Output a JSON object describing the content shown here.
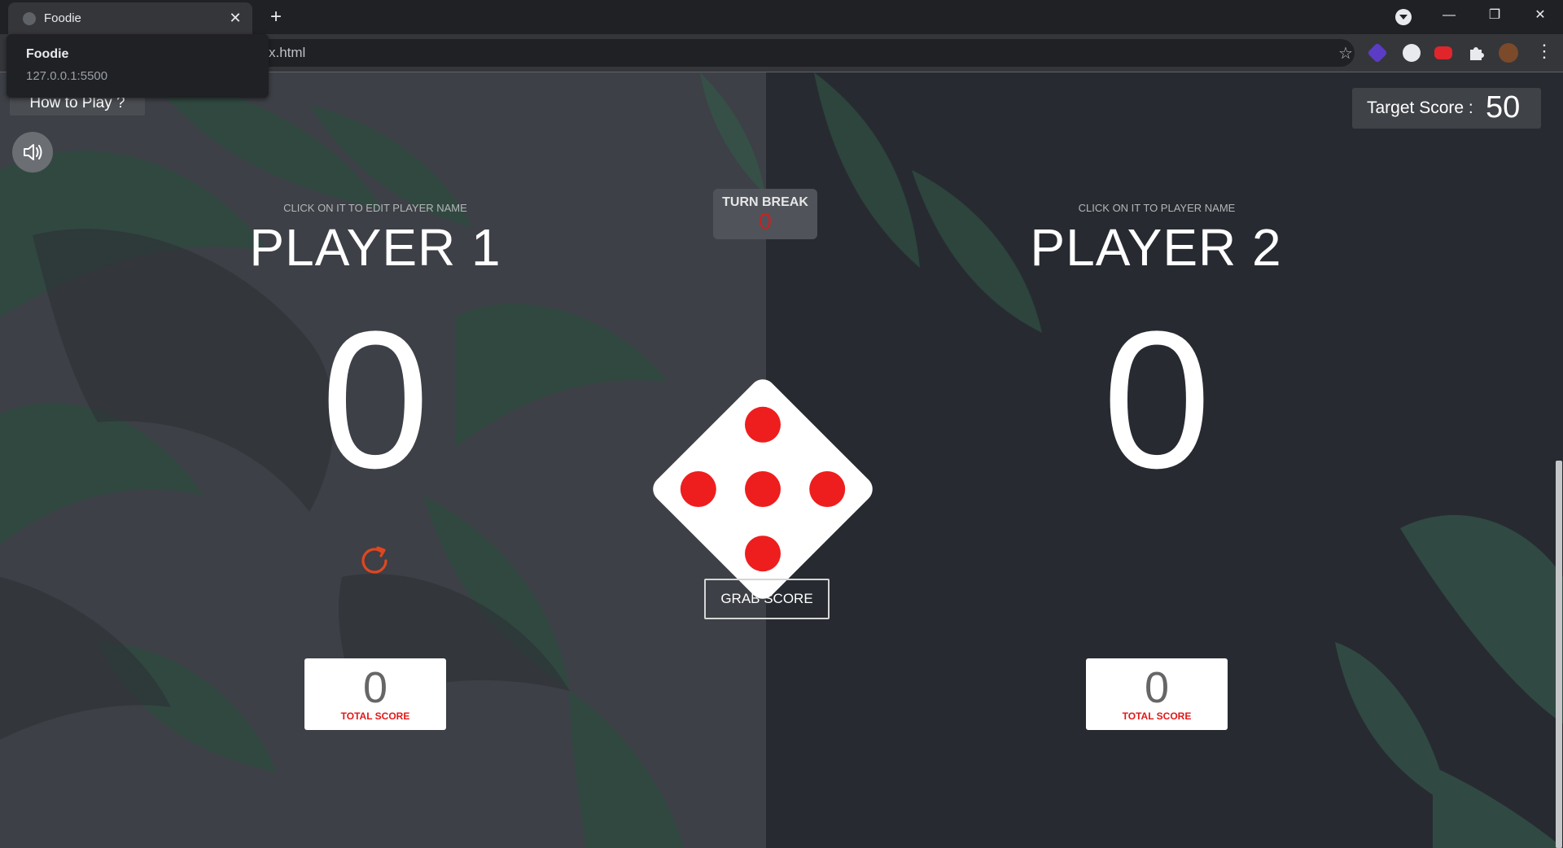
{
  "browser": {
    "tab_title": "Foodie",
    "tab_close": "✕",
    "new_tab": "+",
    "url_visible": "x.html",
    "tooltip_title": "Foodie",
    "tooltip_url": "127.0.0.1:5500",
    "window_controls": {
      "minimize": "—",
      "restore": "❐",
      "close": "✕"
    },
    "menu": "⋮",
    "star": "☆"
  },
  "game": {
    "how_to_play": "How to Play ?",
    "target_label": "Target Score :",
    "target_value": "50",
    "turn_break_label": "TURN BREAK",
    "turn_break_value": "0",
    "grab_score": "GRAB SCORE",
    "dice_value": 5,
    "player1": {
      "hint": "CLICK ON IT TO EDIT PLAYER NAME",
      "name": "PLAYER 1",
      "current_score": "0",
      "total_score": "0",
      "total_label": "TOTAL SCORE"
    },
    "player2": {
      "hint": "CLICK ON IT TO PLAYER NAME",
      "name": "PLAYER 2",
      "current_score": "0",
      "total_score": "0",
      "total_label": "TOTAL SCORE"
    },
    "colors": {
      "pip": "#ee1e1e",
      "accent_red": "#e01818",
      "reset_icon": "#e2461f"
    }
  }
}
